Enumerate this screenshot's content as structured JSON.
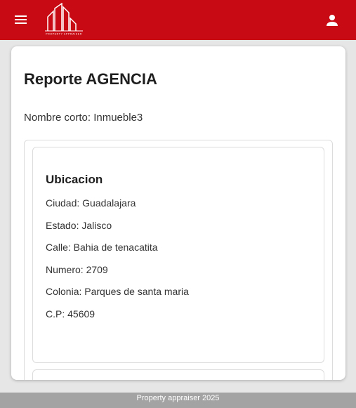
{
  "header": {
    "menu_icon": "menu-icon",
    "logo_text": "PROPERTY APPRAISER",
    "user_icon": "person-icon",
    "brand_color": "#c80a14"
  },
  "report": {
    "title": "Reporte AGENCIA",
    "short_name_label": "Nombre corto:",
    "short_name_value": "Inmueble3",
    "short_name_line": "Nombre corto: Inmueble3"
  },
  "location": {
    "title": "Ubicacion",
    "fields": [
      "Ciudad: Guadalajara",
      "Estado: Jalisco",
      "Calle: Bahia de tenacatita",
      "Numero: 2709",
      "Colonia: Parques de santa maria",
      "C.P: 45609"
    ]
  },
  "footer": {
    "text": "Property appraiser 2025"
  }
}
